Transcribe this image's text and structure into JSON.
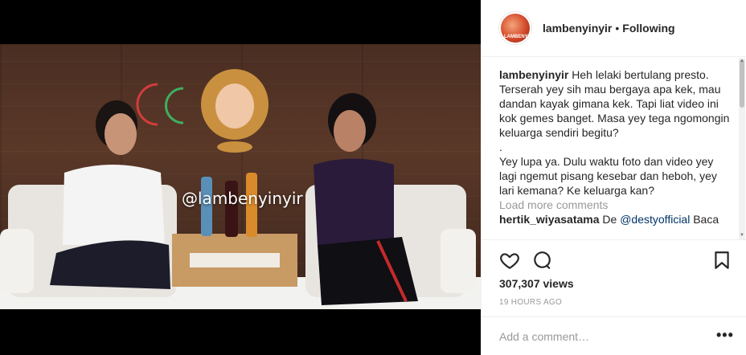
{
  "video": {
    "watermark": "@lambenyinyir"
  },
  "header": {
    "username": "lambenyinyir",
    "separator": "•",
    "follow_status": "Following",
    "avatar_label": "LAMBENYINYIR"
  },
  "caption": {
    "username": "lambenyinyir",
    "line1": "Heh lelaki bertulang presto. Terserah yey sih mau bergaya apa kek, mau dandan kayak gimana kek. Tapi liat video ini kok gemes banget. Masa yey tega ngomongin keluarga sendiri begitu?",
    "line2": ".",
    "line3": "Yey lupa ya. Dulu waktu foto dan video yey lagi ngemut pisang kesebar dan heboh, yey lari kemana? Ke keluarga kan?"
  },
  "load_more": "Load more comments",
  "reply": {
    "username": "hertik_wiyasatama",
    "text_before": "De ",
    "mention": "@destyofficial",
    "text_after": " Baca"
  },
  "icons": {
    "like": "heart-icon",
    "comment": "comment-icon",
    "save": "bookmark-icon",
    "options": "more-options-icon"
  },
  "stats": {
    "views": "307,307 views",
    "timestamp": "19 HOURS AGO"
  },
  "comment_input": {
    "placeholder": "Add a comment…",
    "value": ""
  },
  "more_options_label": "•••"
}
